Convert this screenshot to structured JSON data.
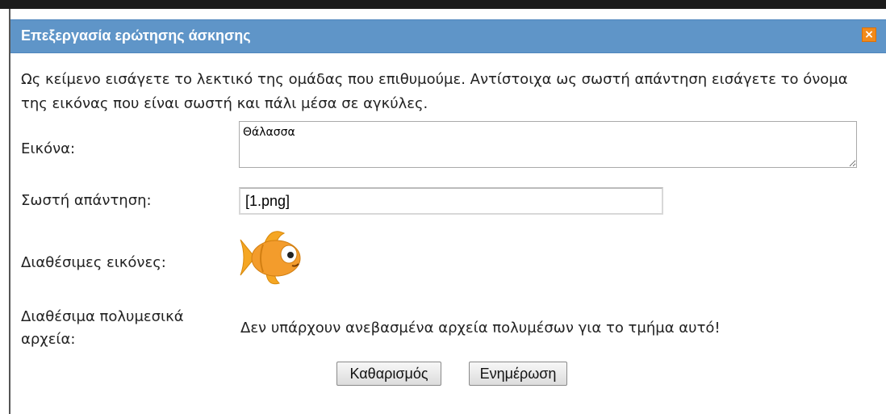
{
  "dialog": {
    "title": "Επεξεργασία ερώτησης άσκησης",
    "close_label": "×"
  },
  "instructions": "Ως κείμενο εισάγετε το λεκτικό της ομάδας που επιθυμούμε. Αντίστοιχα ως σωστή απάντηση εισάγετε το όνομα της εικόνας που είναι σωστή και πάλι μέσα σε αγκύλες.",
  "form": {
    "image_label": "Εικόνα:",
    "image_value": "Θάλασσα",
    "correct_label": "Σωστή απάντηση:",
    "correct_value": "[1.png]",
    "available_images_label": "Διαθέσιμες εικόνες:",
    "media_label": "Διαθέσιμα πολυμεσικά αρχεία:",
    "media_empty_text": "Δεν υπάρχουν ανεβασμένα αρχεία πολυμέσων για το τμήμα αυτό!"
  },
  "buttons": {
    "clear": "Καθαρισμός",
    "update": "Ενημέρωση"
  },
  "images": [
    {
      "name": "1.png",
      "icon": "goldfish-icon"
    }
  ],
  "colors": {
    "titlebar": "#5f95c8",
    "close_button": "#f28a1a"
  }
}
